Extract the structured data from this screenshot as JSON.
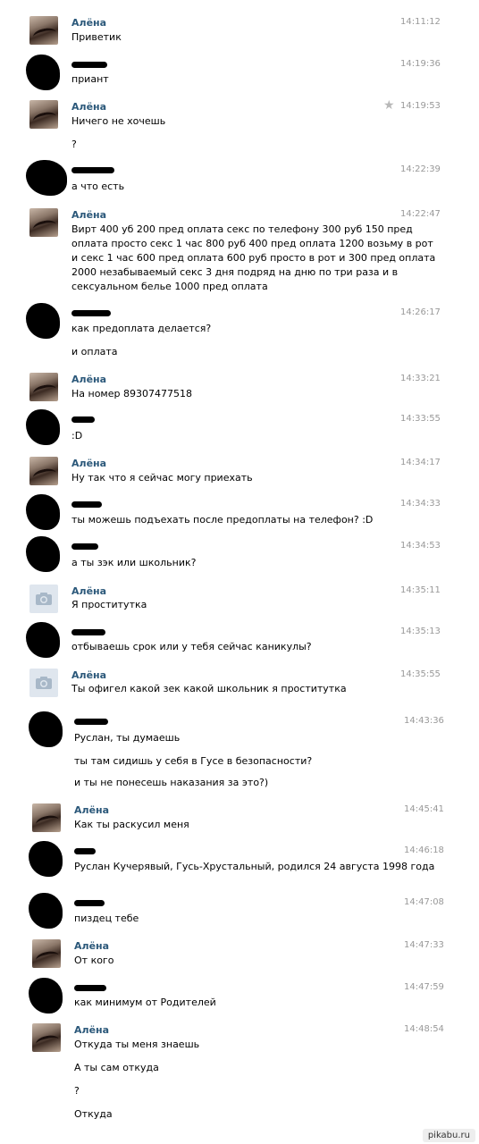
{
  "messages": [
    {
      "author": "Алёна",
      "time": "14:11:12",
      "lines": [
        "Приветик"
      ]
    },
    {
      "author": "",
      "time": "14:19:36",
      "lines": [
        "приант"
      ]
    },
    {
      "author": "Алёна",
      "time": "14:19:53",
      "lines": [
        "Ничего не хочешь",
        "?"
      ]
    },
    {
      "author": "",
      "time": "14:22:39",
      "lines": [
        "а что есть"
      ]
    },
    {
      "author": "Алёна",
      "time": "14:22:47",
      "lines": [
        "Вирт 400 уб 200 пред оплата секс по телефону 300 руб 150 пред",
        "оплата просто секс 1 час 800 руб 400 пред оплата 1200 возьму в рот",
        "и секс 1 час 600 пред оплата 600 руб просто в рот и 300 пред оплата",
        "2000 незабываемый секс 3 дня подряд на дню по три раза и в",
        "сексуальном белье 1000 пред оплата"
      ]
    },
    {
      "author": "",
      "time": "14:26:17",
      "lines": [
        "как предоплата делается?",
        "и оплата"
      ]
    },
    {
      "author": "Алёна",
      "time": "14:33:21",
      "lines": [
        "На номер 89307477518"
      ]
    },
    {
      "author": "",
      "time": "14:33:55",
      "lines": [
        ":D"
      ]
    },
    {
      "author": "Алёна",
      "time": "14:34:17",
      "lines": [
        "Ну так что я сейчас могу приехать"
      ]
    },
    {
      "author": "",
      "time": "14:34:33",
      "lines": [
        "ты можешь подъехать после предоплаты на телефон? :D"
      ]
    },
    {
      "author": "",
      "time": "14:34:53",
      "lines": [
        "а ты зэк или школьник?"
      ]
    },
    {
      "author": "Алёна",
      "time": "14:35:11",
      "lines": [
        "Я проститутка"
      ]
    },
    {
      "author": "",
      "time": "14:35:13",
      "lines": [
        "отбываешь срок или у тебя сейчас каникулы?"
      ]
    },
    {
      "author": "Алёна",
      "time": "14:35:55",
      "lines": [
        "Ты офигел какой зек какой школьник я проститутка"
      ]
    },
    {
      "author": "",
      "time": "14:43:36",
      "lines": [
        "Руслан, ты думаешь",
        "ты там сидишь у себя в Гусе в безопасности?",
        "и ты не понесешь наказания за это?)"
      ]
    },
    {
      "author": "Алёна",
      "time": "14:45:41",
      "lines": [
        "Как ты раскусил меня"
      ]
    },
    {
      "author": "",
      "time": "14:46:18",
      "lines": [
        "Руслан Кучерявый, Гусь-Хрустальный, родился 24 августа 1998 года"
      ]
    },
    {
      "author": "",
      "time": "14:47:08",
      "lines": [
        "пиздец тебе"
      ]
    },
    {
      "author": "Алёна",
      "time": "14:47:33",
      "lines": [
        "От кого"
      ]
    },
    {
      "author": "",
      "time": "14:47:59",
      "lines": [
        "как минимум от Родителей"
      ]
    },
    {
      "author": "Алёна",
      "time": "14:48:54",
      "lines": [
        "Откуда ты меня знаешь",
        "А ты сам откуда",
        "?",
        "Откуда"
      ]
    }
  ],
  "watermark": "pikabu.ru",
  "colors": {
    "name": "#2b587a",
    "time": "#999999"
  }
}
